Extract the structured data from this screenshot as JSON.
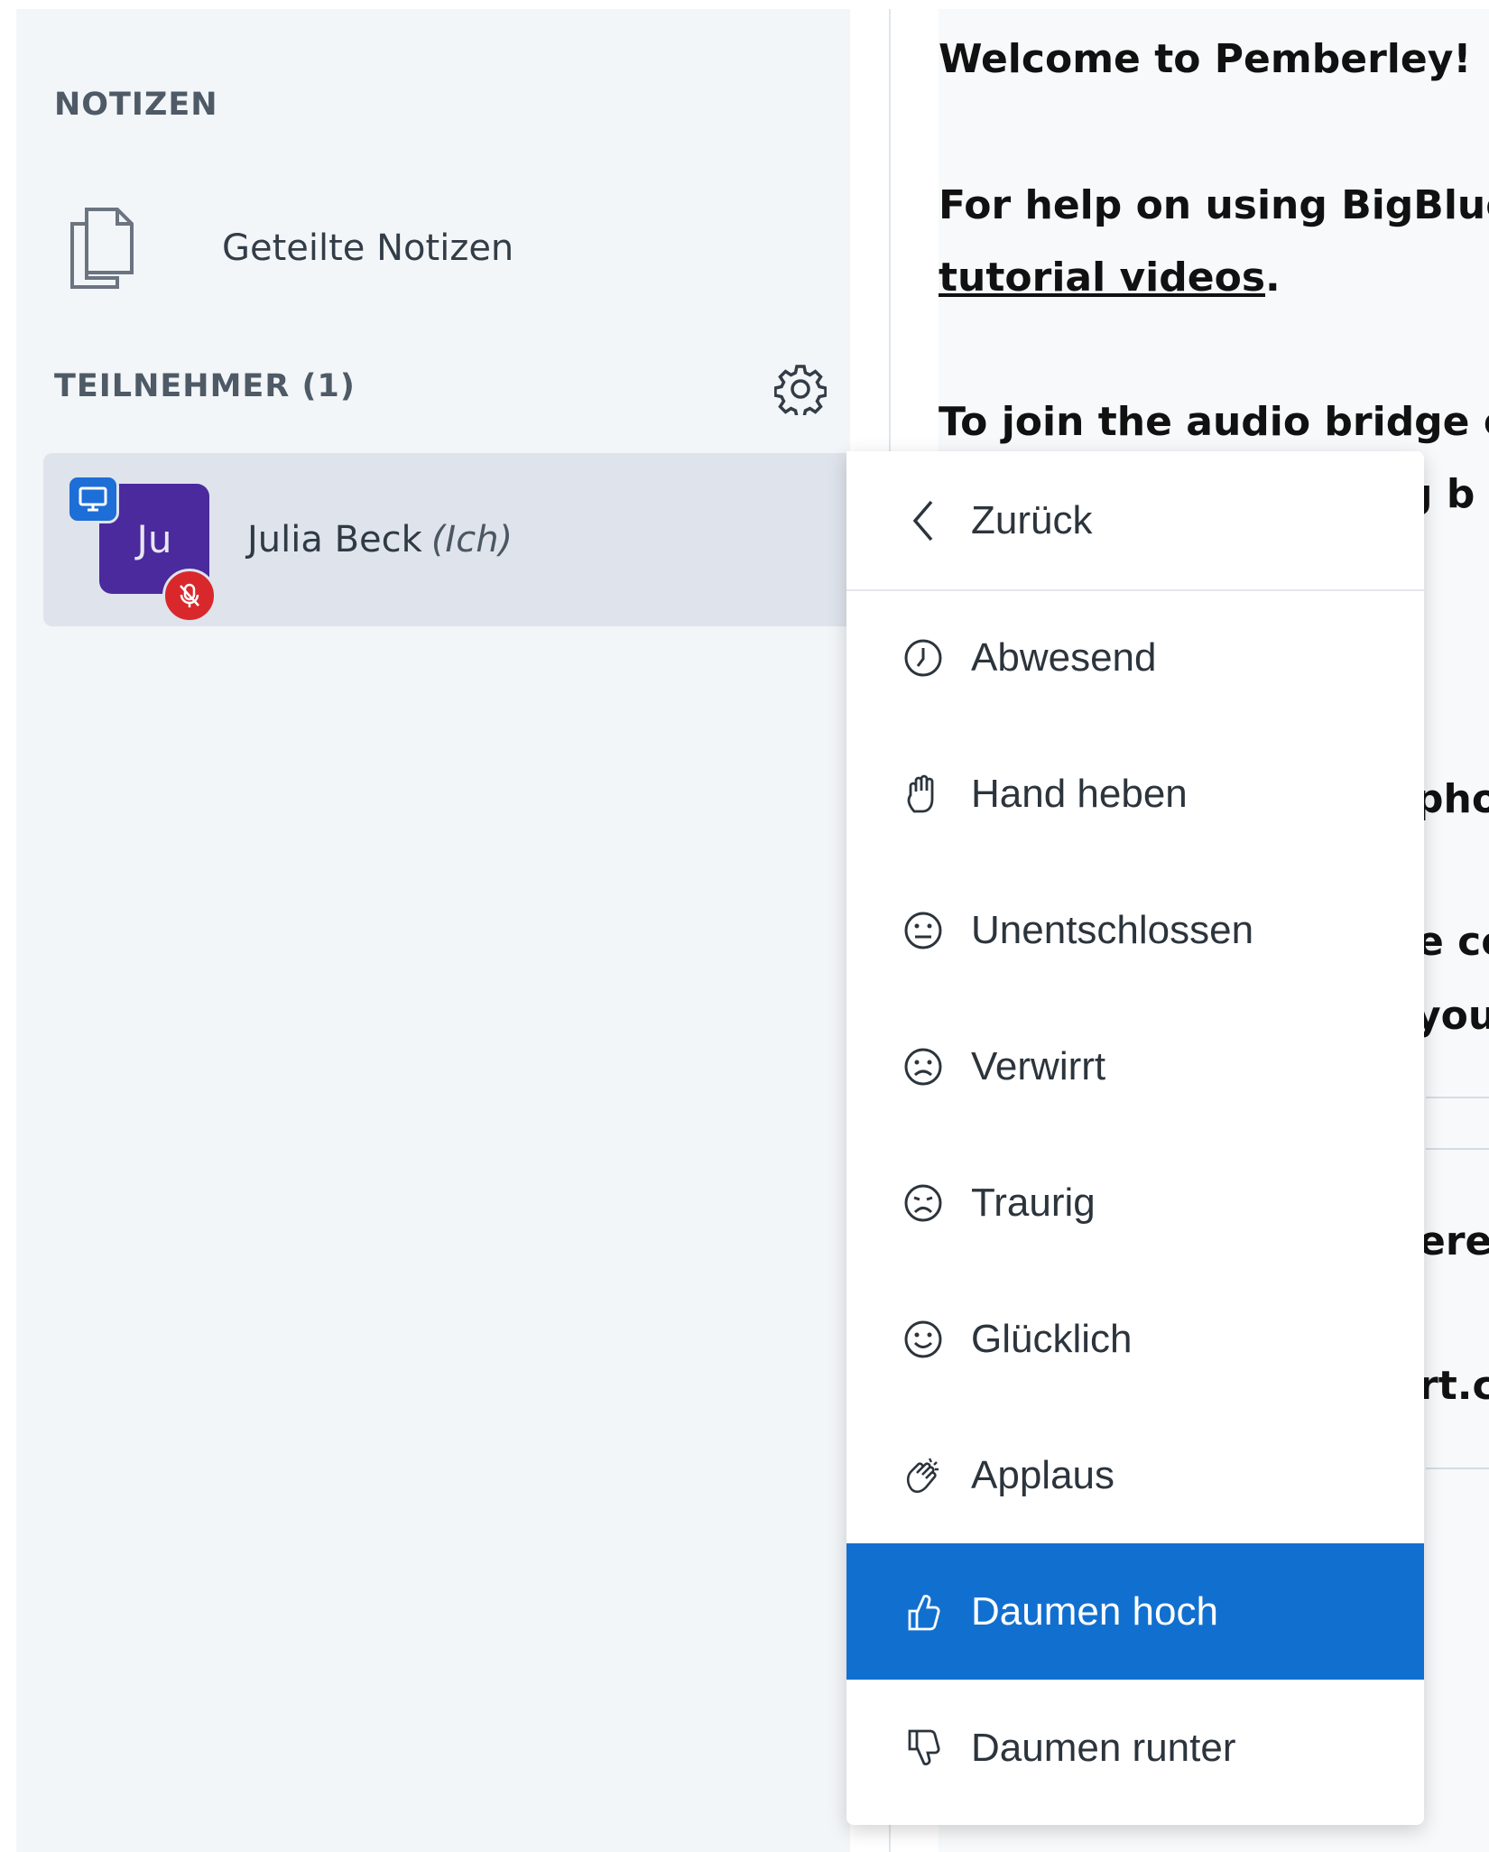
{
  "notes_section": {
    "title": "NOTIZEN",
    "shared_notes_label": "Geteilte Notizen"
  },
  "participants_section": {
    "title": "TEILNEHMER (1)"
  },
  "user": {
    "initials": "Ju",
    "name": "Julia Beck",
    "self_tag": "(Ich)"
  },
  "welcome": {
    "line1_a": "Welcome to ",
    "line1_b": "Pemberley!",
    "line2": "For help on using BigBlueB",
    "line3_link": "tutorial videos",
    "line3_dot": ".",
    "line4": "To join the audio bridge cli",
    "frag_gb": "g b",
    "frag_pho": "pho",
    "frag_eco": "e co",
    "frag_you": "you",
    "frag_ere": "ere",
    "frag_rt": "rt.c"
  },
  "menu": {
    "back_label": "Zurück",
    "items": [
      {
        "label": "Abwesend",
        "icon": "clock-icon"
      },
      {
        "label": "Hand heben",
        "icon": "hand-icon"
      },
      {
        "label": "Unentschlossen",
        "icon": "neutral-face-icon"
      },
      {
        "label": "Verwirrt",
        "icon": "confused-face-icon"
      },
      {
        "label": "Traurig",
        "icon": "sad-face-icon"
      },
      {
        "label": "Glücklich",
        "icon": "happy-face-icon"
      },
      {
        "label": "Applaus",
        "icon": "applause-icon"
      },
      {
        "label": "Daumen hoch",
        "icon": "thumbs-up-icon"
      },
      {
        "label": "Daumen runter",
        "icon": "thumbs-down-icon"
      }
    ],
    "active_index": 7
  },
  "colors": {
    "accent": "#1170cf",
    "avatar": "#4a2a9d",
    "mic_badge": "#d9282c",
    "presenter_badge": "#1d6ed6"
  }
}
